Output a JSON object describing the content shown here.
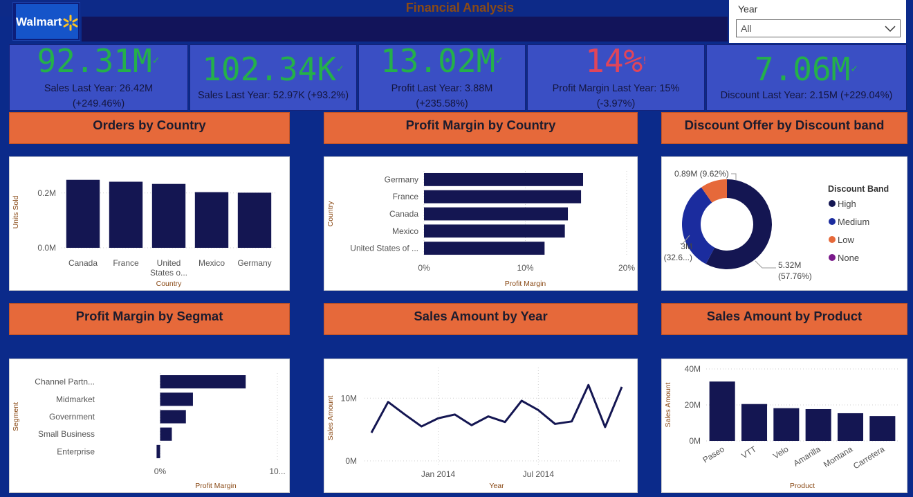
{
  "header": {
    "title": "Financial Analysis",
    "logo_text": "Walmart"
  },
  "filter": {
    "label": "Year",
    "selected": "All"
  },
  "kpis": [
    {
      "value": "92.31M",
      "status": "good",
      "line1": "Sales Last Year: 26.42M",
      "line2": "(+249.46%)"
    },
    {
      "value": "102.34K",
      "status": "good",
      "line1": "Sales Last Year: 52.97K (+93.2%)",
      "line2": ""
    },
    {
      "value": "13.02M",
      "status": "good",
      "line1": "Profit Last Year: 3.88M",
      "line2": "(+235.58%)"
    },
    {
      "value": "14%",
      "status": "bad",
      "line1": "Profit Margin Last Year: 15%",
      "line2": "(-3.97%)"
    },
    {
      "value": "7.06M",
      "status": "good",
      "line1": "Discount Last Year: 2.15M (+229.04%)",
      "line2": ""
    }
  ],
  "colors": {
    "bar": "#141652",
    "header": "#e6693a",
    "good": "#24b04a",
    "bad": "#e0455a",
    "high": "#141652",
    "medium": "#1b2c9e",
    "low": "#e6693a",
    "none": "#7a1a8a"
  },
  "sections": {
    "orders": "Orders by Country",
    "margin_country": "Profit Margin by Country",
    "discount": "Discount Offer by Discount band",
    "margin_segment": "Profit Margin by Segmat",
    "sales_year": "Sales Amount by Year",
    "sales_product": "Sales Amount by Product"
  },
  "chart_data": [
    {
      "id": "orders",
      "type": "bar",
      "title": "Orders by Country",
      "xlabel": "Country",
      "ylabel": "Units Sold",
      "categories": [
        "Canada",
        "France",
        "United States o...",
        "Mexico",
        "Germany"
      ],
      "values": [
        0.248,
        0.241,
        0.233,
        0.203,
        0.201
      ],
      "yticks": [
        {
          "v": 0,
          "label": "0.0M"
        },
        {
          "v": 0.2,
          "label": "0.2M"
        }
      ],
      "ylim": [
        0,
        0.26
      ],
      "grid": true
    },
    {
      "id": "margin_country",
      "type": "bar",
      "orientation": "horizontal",
      "title": "Profit Margin by Country",
      "xlabel": "Profit Margin",
      "ylabel": "Country",
      "categories": [
        "Germany",
        "France",
        "Canada",
        "Mexico",
        "United States of ..."
      ],
      "values": [
        0.157,
        0.155,
        0.142,
        0.139,
        0.119
      ],
      "xticks": [
        {
          "v": 0,
          "label": "0%"
        },
        {
          "v": 0.1,
          "label": "10%"
        },
        {
          "v": 0.2,
          "label": "20%"
        }
      ],
      "xlim": [
        0,
        0.2
      ],
      "grid": true
    },
    {
      "id": "discount",
      "type": "pie",
      "donut": true,
      "title": "Discount Offer by Discount band",
      "legend_title": "Discount Band",
      "legend_position": "right",
      "series": [
        {
          "name": "High",
          "value": 5.32,
          "color_key": "high",
          "label1": "5.32M",
          "label2": "(57.76%)"
        },
        {
          "name": "Medium",
          "value": 3.0,
          "color_key": "medium",
          "label1": "3M",
          "label2": "(32.6...)"
        },
        {
          "name": "Low",
          "value": 0.89,
          "color_key": "low",
          "label1": "0.89M (9.62%)",
          "label2": ""
        },
        {
          "name": "None",
          "value": 0,
          "color_key": "none",
          "label1": "",
          "label2": ""
        }
      ]
    },
    {
      "id": "margin_segment",
      "type": "bar",
      "orientation": "horizontal",
      "title": "Profit Margin by Segmat",
      "xlabel": "Profit Margin",
      "ylabel": "Segment",
      "categories": [
        "Channel Partn...",
        "Midmarket",
        "Government",
        "Small Business",
        "Enterprise"
      ],
      "values": [
        0.73,
        0.28,
        0.22,
        0.1,
        -0.03
      ],
      "xticks": [
        {
          "v": 0,
          "label": "0%"
        },
        {
          "v": 1,
          "label": "10..."
        }
      ],
      "xlim": [
        -0.05,
        1.0
      ],
      "grid": true
    },
    {
      "id": "sales_year",
      "type": "line",
      "title": "Sales Amount by Year",
      "xlabel": "Year",
      "ylabel": "Sales Amount",
      "x": [
        "Sep 2013",
        "Oct 2013",
        "Nov 2013",
        "Dec 2013",
        "Jan 2014",
        "Feb 2014",
        "Mar 2014",
        "Apr 2014",
        "May 2014",
        "Jun 2014",
        "Jul 2014",
        "Aug 2014",
        "Sep 2014",
        "Oct 2014",
        "Nov 2014",
        "Dec 2014"
      ],
      "values": [
        4.5,
        9.4,
        7.4,
        5.5,
        6.8,
        7.4,
        5.7,
        7.1,
        6.2,
        9.6,
        8.1,
        5.9,
        6.3,
        12.1,
        5.4,
        11.8
      ],
      "xticks": [
        {
          "i": 4,
          "label": "Jan 2014"
        },
        {
          "i": 10,
          "label": "Jul 2014"
        }
      ],
      "yticks": [
        {
          "v": 0,
          "label": "0M"
        },
        {
          "v": 10,
          "label": "10M"
        }
      ],
      "ylim": [
        -1,
        14
      ],
      "grid": true
    },
    {
      "id": "sales_product",
      "type": "bar",
      "title": "Sales Amount by Product",
      "xlabel": "Product",
      "ylabel": "Sales Amount",
      "categories": [
        "Paseo",
        "VTT",
        "Velo",
        "Amarilla",
        "Montana",
        "Carretera"
      ],
      "values": [
        33,
        20.5,
        18.2,
        17.7,
        15.4,
        13.8
      ],
      "yticks": [
        {
          "v": 0,
          "label": "0M"
        },
        {
          "v": 20,
          "label": "20M"
        },
        {
          "v": 40,
          "label": "40M"
        }
      ],
      "ylim": [
        0,
        40
      ],
      "grid": true
    }
  ]
}
